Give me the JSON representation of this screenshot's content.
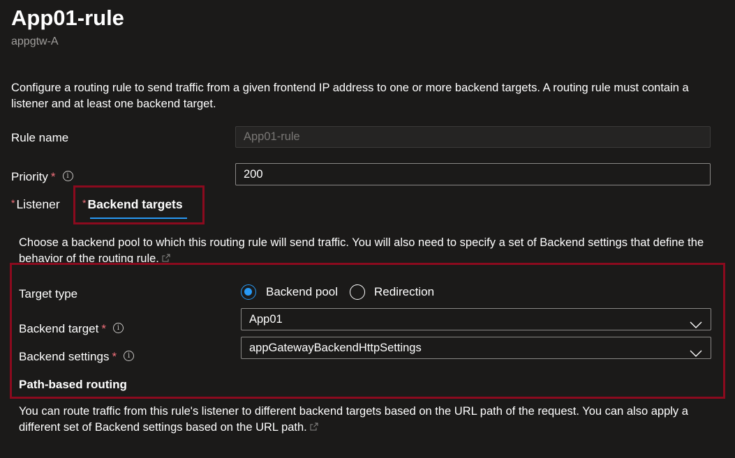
{
  "page": {
    "title": "App01-rule",
    "subtitle": "appgtw-A"
  },
  "intro": "Configure a routing rule to send traffic from a given frontend IP address to one or more backend targets. A routing rule must contain a listener and at least one backend target.",
  "rule_name": {
    "label": "Rule name",
    "value": "App01-rule"
  },
  "priority": {
    "label": "Priority",
    "required": "*",
    "value": "200"
  },
  "tabs": [
    {
      "label": "Listener",
      "required": "*"
    },
    {
      "label": "Backend targets",
      "required": "*"
    }
  ],
  "backend_desc": "Choose a backend pool to which this routing rule will send traffic. You will also need to specify a set of Backend settings that define the behavior of the routing rule.",
  "target_type": {
    "label": "Target type",
    "options": [
      {
        "label": "Backend pool",
        "selected": true
      },
      {
        "label": "Redirection",
        "selected": false
      }
    ]
  },
  "backend_target": {
    "label": "Backend target",
    "required": "*",
    "value": "App01"
  },
  "backend_settings": {
    "label": "Backend settings",
    "required": "*",
    "value": "appGatewayBackendHttpSettings"
  },
  "path_routing": {
    "heading": "Path-based routing",
    "desc": "You can route traffic from this rule's listener to different backend targets based on the URL path of the request. You can also apply a different set of Backend settings based on the URL path."
  },
  "colors": {
    "accent": "#2899f5",
    "required": "#f1707b",
    "highlight_box": "#8b0a1e",
    "background": "#1b1a19"
  },
  "icons": {
    "info": "info-icon",
    "external_link": "external-link-icon",
    "chevron": "chevron-down-icon"
  }
}
